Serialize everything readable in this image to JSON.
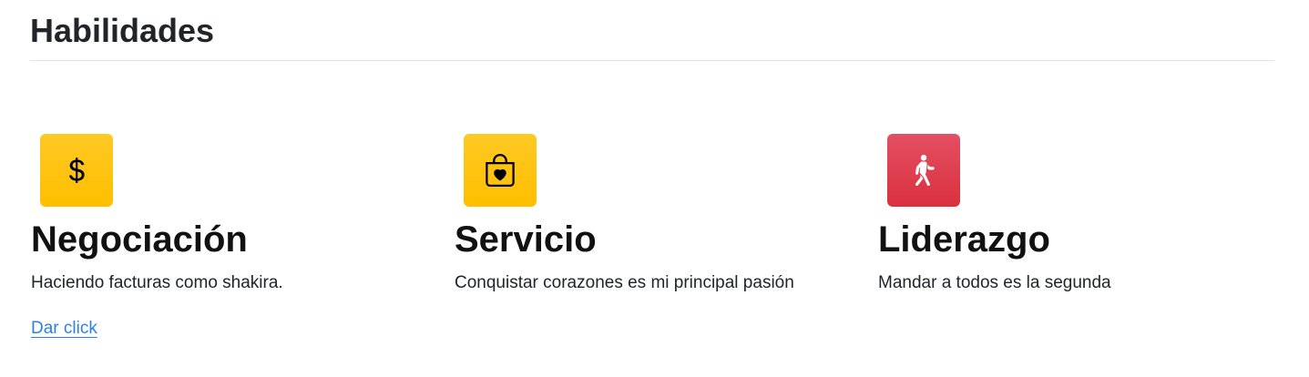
{
  "section": {
    "title": "Habilidades"
  },
  "features": [
    {
      "icon": "dollar-icon",
      "icon_color": "#ffc107",
      "title": "Negociación",
      "description": "Haciendo facturas como shakira.",
      "link_label": "Dar click"
    },
    {
      "icon": "shopping-bag-heart-icon",
      "icon_color": "#ffc107",
      "title": "Servicio",
      "description": "Conquistar corazones es mi principal pasión"
    },
    {
      "icon": "person-walking-icon",
      "icon_color": "#dc3545",
      "title": "Liderazgo",
      "description": "Mandar a todos es la segunda"
    }
  ],
  "colors": {
    "text": "#212529",
    "link": "#2f7fe6",
    "yellow": "#ffc107",
    "red": "#dc3545",
    "divider": "#dee2e6"
  }
}
